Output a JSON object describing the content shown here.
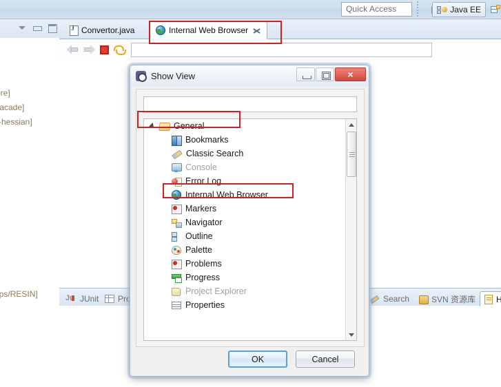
{
  "toolbar": {
    "quick_access_placeholder": "Quick Access",
    "open_perspective_icon": "open-perspective-icon",
    "perspective_label": "Java EE",
    "perspective_icon": "java-ee-icon",
    "extra_perspective_icon": "perspective-icon"
  },
  "left_view": {
    "menu_icon": "view-menu-icon",
    "minimize_icon": "minimize-icon",
    "maximize_icon": "maximize-icon",
    "clipped_lines": [
      "ore]",
      "-facade]",
      "k-hessian]",
      "pps/RESIN]"
    ]
  },
  "editor": {
    "tabs": [
      {
        "label": "Convertor.java",
        "icon": "java-file-icon",
        "active": false,
        "closable": false
      },
      {
        "label": "Internal Web Browser",
        "icon": "globe-icon",
        "active": true,
        "closable": true
      }
    ],
    "browser_toolbar": {
      "back_icon": "back-arrow-icon",
      "forward_icon": "forward-arrow-icon",
      "stop_icon": "stop-icon",
      "refresh_icon": "refresh-icon",
      "url_value": ""
    }
  },
  "bottom_tabs": [
    {
      "label": "JUnit",
      "icon": "junit-icon",
      "active": false
    },
    {
      "label": "Pro",
      "icon": "table-icon",
      "active": false
    },
    {
      "label": "Search",
      "icon": "search-pencil-icon",
      "active": false
    },
    {
      "label": "SVN 资源库",
      "icon": "svn-icon",
      "active": false
    },
    {
      "label": "H",
      "icon": "document-icon",
      "active": true
    }
  ],
  "dialog": {
    "title": "Show View",
    "title_icon": "show-view-icon",
    "window_buttons": {
      "minimize": "minimize-icon",
      "maximize": "restore-icon",
      "close": "×"
    },
    "filter_value": "",
    "tree": [
      {
        "label": "General",
        "icon": "folder-icon",
        "level": 0,
        "expanded": true,
        "disabled": false,
        "highlighted": true
      },
      {
        "label": "Bookmarks",
        "icon": "bookmarks-icon",
        "level": 1,
        "disabled": false,
        "highlighted": false
      },
      {
        "label": "Classic Search",
        "icon": "classic-search-icon",
        "level": 1,
        "disabled": false,
        "highlighted": false
      },
      {
        "label": "Console",
        "icon": "console-icon",
        "level": 1,
        "disabled": true,
        "highlighted": false
      },
      {
        "label": "Error Log",
        "icon": "error-log-icon",
        "level": 1,
        "disabled": false,
        "highlighted": false
      },
      {
        "label": "Internal Web Browser",
        "icon": "globe-icon",
        "level": 1,
        "disabled": false,
        "highlighted": true,
        "selected": true
      },
      {
        "label": "Markers",
        "icon": "markers-icon",
        "level": 1,
        "disabled": false,
        "highlighted": false
      },
      {
        "label": "Navigator",
        "icon": "navigator-icon",
        "level": 1,
        "disabled": false,
        "highlighted": false
      },
      {
        "label": "Outline",
        "icon": "outline-icon",
        "level": 1,
        "disabled": false,
        "highlighted": false
      },
      {
        "label": "Palette",
        "icon": "palette-icon",
        "level": 1,
        "disabled": false,
        "highlighted": false
      },
      {
        "label": "Problems",
        "icon": "problems-icon",
        "level": 1,
        "disabled": false,
        "highlighted": false
      },
      {
        "label": "Progress",
        "icon": "progress-icon",
        "level": 1,
        "disabled": false,
        "highlighted": false
      },
      {
        "label": "Project Explorer",
        "icon": "project-explorer-icon",
        "level": 1,
        "disabled": true,
        "highlighted": false
      },
      {
        "label": "Properties",
        "icon": "properties-icon",
        "level": 1,
        "disabled": false,
        "highlighted": false
      }
    ],
    "scrollbar": {
      "up_icon": "scroll-up-icon",
      "down_icon": "scroll-down-icon"
    },
    "buttons": {
      "ok": "OK",
      "cancel": "Cancel"
    }
  },
  "annotations": {
    "accent_color": "#cf1f1f",
    "count": 3
  }
}
